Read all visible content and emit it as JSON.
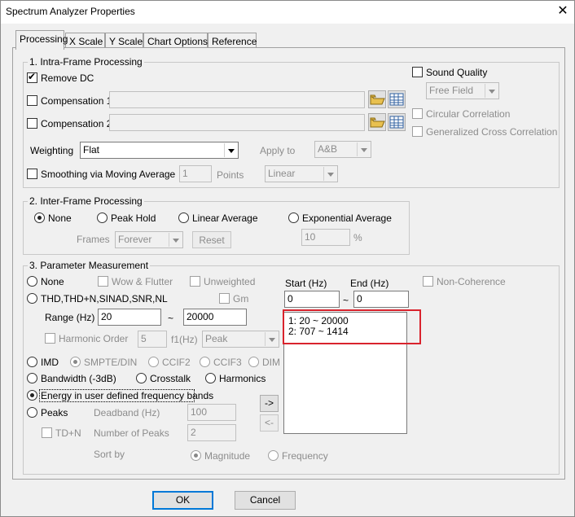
{
  "window": {
    "title": "Spectrum Analyzer Properties",
    "close_glyph": "✕"
  },
  "tabs": [
    "Processing",
    "X Scale",
    "Y Scale",
    "Chart Options",
    "Reference"
  ],
  "intra": {
    "legend": "1. Intra-Frame Processing",
    "remove_dc": "Remove DC",
    "compensation1": "Compensation 1",
    "compensation2": "Compensation 2",
    "weighting_label": "Weighting",
    "weighting_value": "Flat",
    "apply_to_label": "Apply to",
    "apply_to_value": "A&B",
    "smoothing_label": "Smoothing via Moving Average",
    "smoothing_value": "1",
    "points_label": "Points",
    "smoothing_type": "Linear",
    "sound_quality": "Sound Quality",
    "sound_field": "Free Field",
    "circular_correlation": "Circular Correlation",
    "gcc": "Generalized Cross Correlation"
  },
  "inter": {
    "legend": "2. Inter-Frame Processing",
    "none": "None",
    "peak_hold": "Peak Hold",
    "linear_average": "Linear Average",
    "exponential_average": "Exponential Average",
    "frames_label": "Frames",
    "frames_value": "Forever",
    "reset": "Reset",
    "exp_value": "10",
    "percent": "%"
  },
  "param": {
    "legend": "3. Parameter Measurement",
    "none": "None",
    "wow_flutter": "Wow & Flutter",
    "unweighted": "Unweighted",
    "thd": "THD,THD+N,SINAD,SNR,NL",
    "gm": "Gm",
    "range_label": "Range (Hz)",
    "range_from": "20",
    "tilde": "~",
    "range_to": "20000",
    "harmonic_order": "Harmonic Order",
    "harmonic_value": "5",
    "f1_label": "f1(Hz)",
    "f1_value": "Peak",
    "imd": "IMD",
    "smpte": "SMPTE/DIN",
    "ccif2": "CCIF2",
    "ccif3": "CCIF3",
    "dim": "DIM",
    "bandwidth": "Bandwidth (-3dB)",
    "crosstalk": "Crosstalk",
    "harmonics": "Harmonics",
    "energy": "Energy in user defined frequency bands",
    "peaks": "Peaks",
    "deadband_label": "Deadband (Hz)",
    "deadband_value": "100",
    "tdn": "TD+N",
    "num_peaks_label": "Number of Peaks",
    "num_peaks_value": "2",
    "sort_by": "Sort by",
    "magnitude": "Magnitude",
    "frequency": "Frequency",
    "start_label": "Start (Hz)",
    "end_label": "End (Hz)",
    "start_value": "0",
    "end_value": "0",
    "non_coherence": "Non-Coherence",
    "bands": [
      "1: 20 ~ 20000",
      "2: 707 ~ 1414"
    ],
    "add_button": "->",
    "remove_button": "<-"
  },
  "footer": {
    "ok": "OK",
    "cancel": "Cancel"
  },
  "colors": {
    "highlight": "#d9232d",
    "focus": "#0078d7"
  }
}
